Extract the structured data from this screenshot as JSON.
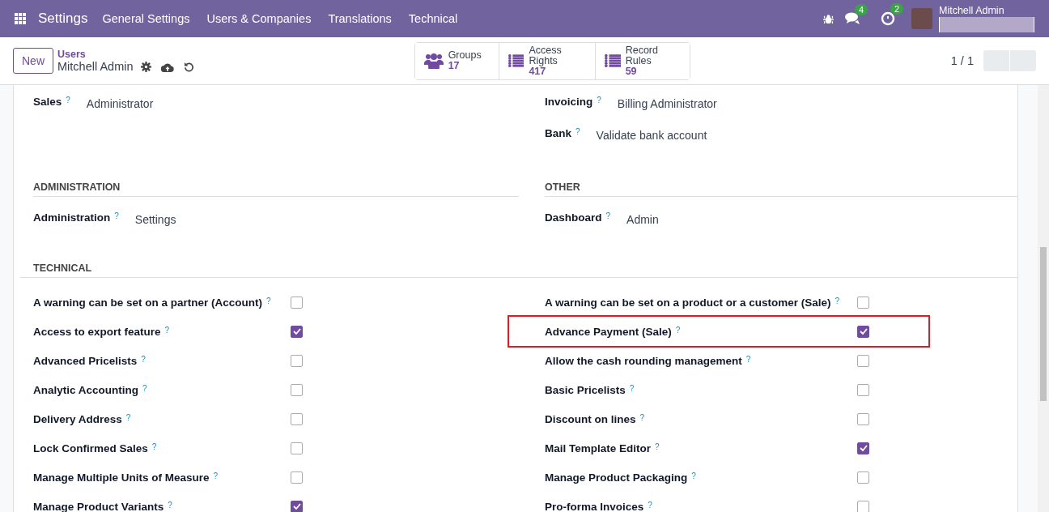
{
  "navbar": {
    "app_title": "Settings",
    "menu": [
      "General Settings",
      "Users & Companies",
      "Translations",
      "Technical"
    ],
    "chat_count": "4",
    "activity_count": "2",
    "user_name": "Mitchell Admin"
  },
  "control_panel": {
    "new_button": "New",
    "breadcrumb_parent": "Users",
    "record_name": "Mitchell Admin",
    "smart_buttons": [
      {
        "kind": "users",
        "label": "Groups",
        "count": "17"
      },
      {
        "kind": "list",
        "label": "Access Rights",
        "count": "417"
      },
      {
        "kind": "list",
        "label": "Record Rules",
        "count": "59"
      }
    ],
    "pager": "1 / 1"
  },
  "sections": [
    {
      "columns": [
        [
          {
            "label": "Sales",
            "help": "?",
            "value": "Administrator"
          }
        ],
        [
          {
            "label": "Invoicing",
            "help": "?",
            "value": "Billing Administrator"
          },
          {
            "label": "Bank",
            "help": "?",
            "value": "Validate bank account"
          }
        ]
      ]
    },
    {
      "column_titles": [
        "ADMINISTRATION",
        "OTHER"
      ],
      "columns": [
        [
          {
            "label": "Administration",
            "help": "?",
            "value": "Settings"
          }
        ],
        [
          {
            "label": "Dashboard",
            "help": "?",
            "value": "Admin"
          }
        ]
      ]
    }
  ],
  "technical": {
    "title": "TECHNICAL",
    "columns": [
      [
        {
          "label": "A warning can be set on a partner (Account)",
          "help": "?",
          "checked": false,
          "highlighted": false
        },
        {
          "label": "Access to export feature",
          "help": "?",
          "checked": true,
          "highlighted": false
        },
        {
          "label": "Advanced Pricelists",
          "help": "?",
          "checked": false,
          "highlighted": false
        },
        {
          "label": "Analytic Accounting",
          "help": "?",
          "checked": false,
          "highlighted": false
        },
        {
          "label": "Delivery Address",
          "help": "?",
          "checked": false,
          "highlighted": false
        },
        {
          "label": "Lock Confirmed Sales",
          "help": "?",
          "checked": false,
          "highlighted": false
        },
        {
          "label": "Manage Multiple Units of Measure",
          "help": "?",
          "checked": false,
          "highlighted": false
        },
        {
          "label": "Manage Product Variants",
          "help": "?",
          "checked": true,
          "highlighted": false
        }
      ],
      [
        {
          "label": "A warning can be set on a product or a customer (Sale)",
          "help": "?",
          "checked": false,
          "highlighted": false
        },
        {
          "label": "Advance Payment (Sale)",
          "help": "?",
          "checked": true,
          "highlighted": true
        },
        {
          "label": "Allow the cash rounding management",
          "help": "?",
          "checked": false,
          "highlighted": false
        },
        {
          "label": "Basic Pricelists",
          "help": "?",
          "checked": false,
          "highlighted": false
        },
        {
          "label": "Discount on lines",
          "help": "?",
          "checked": false,
          "highlighted": false
        },
        {
          "label": "Mail Template Editor",
          "help": "?",
          "checked": true,
          "highlighted": false
        },
        {
          "label": "Manage Product Packaging",
          "help": "?",
          "checked": false,
          "highlighted": false
        },
        {
          "label": "Pro-forma Invoices",
          "help": "?",
          "checked": false,
          "highlighted": false
        }
      ]
    ]
  }
}
